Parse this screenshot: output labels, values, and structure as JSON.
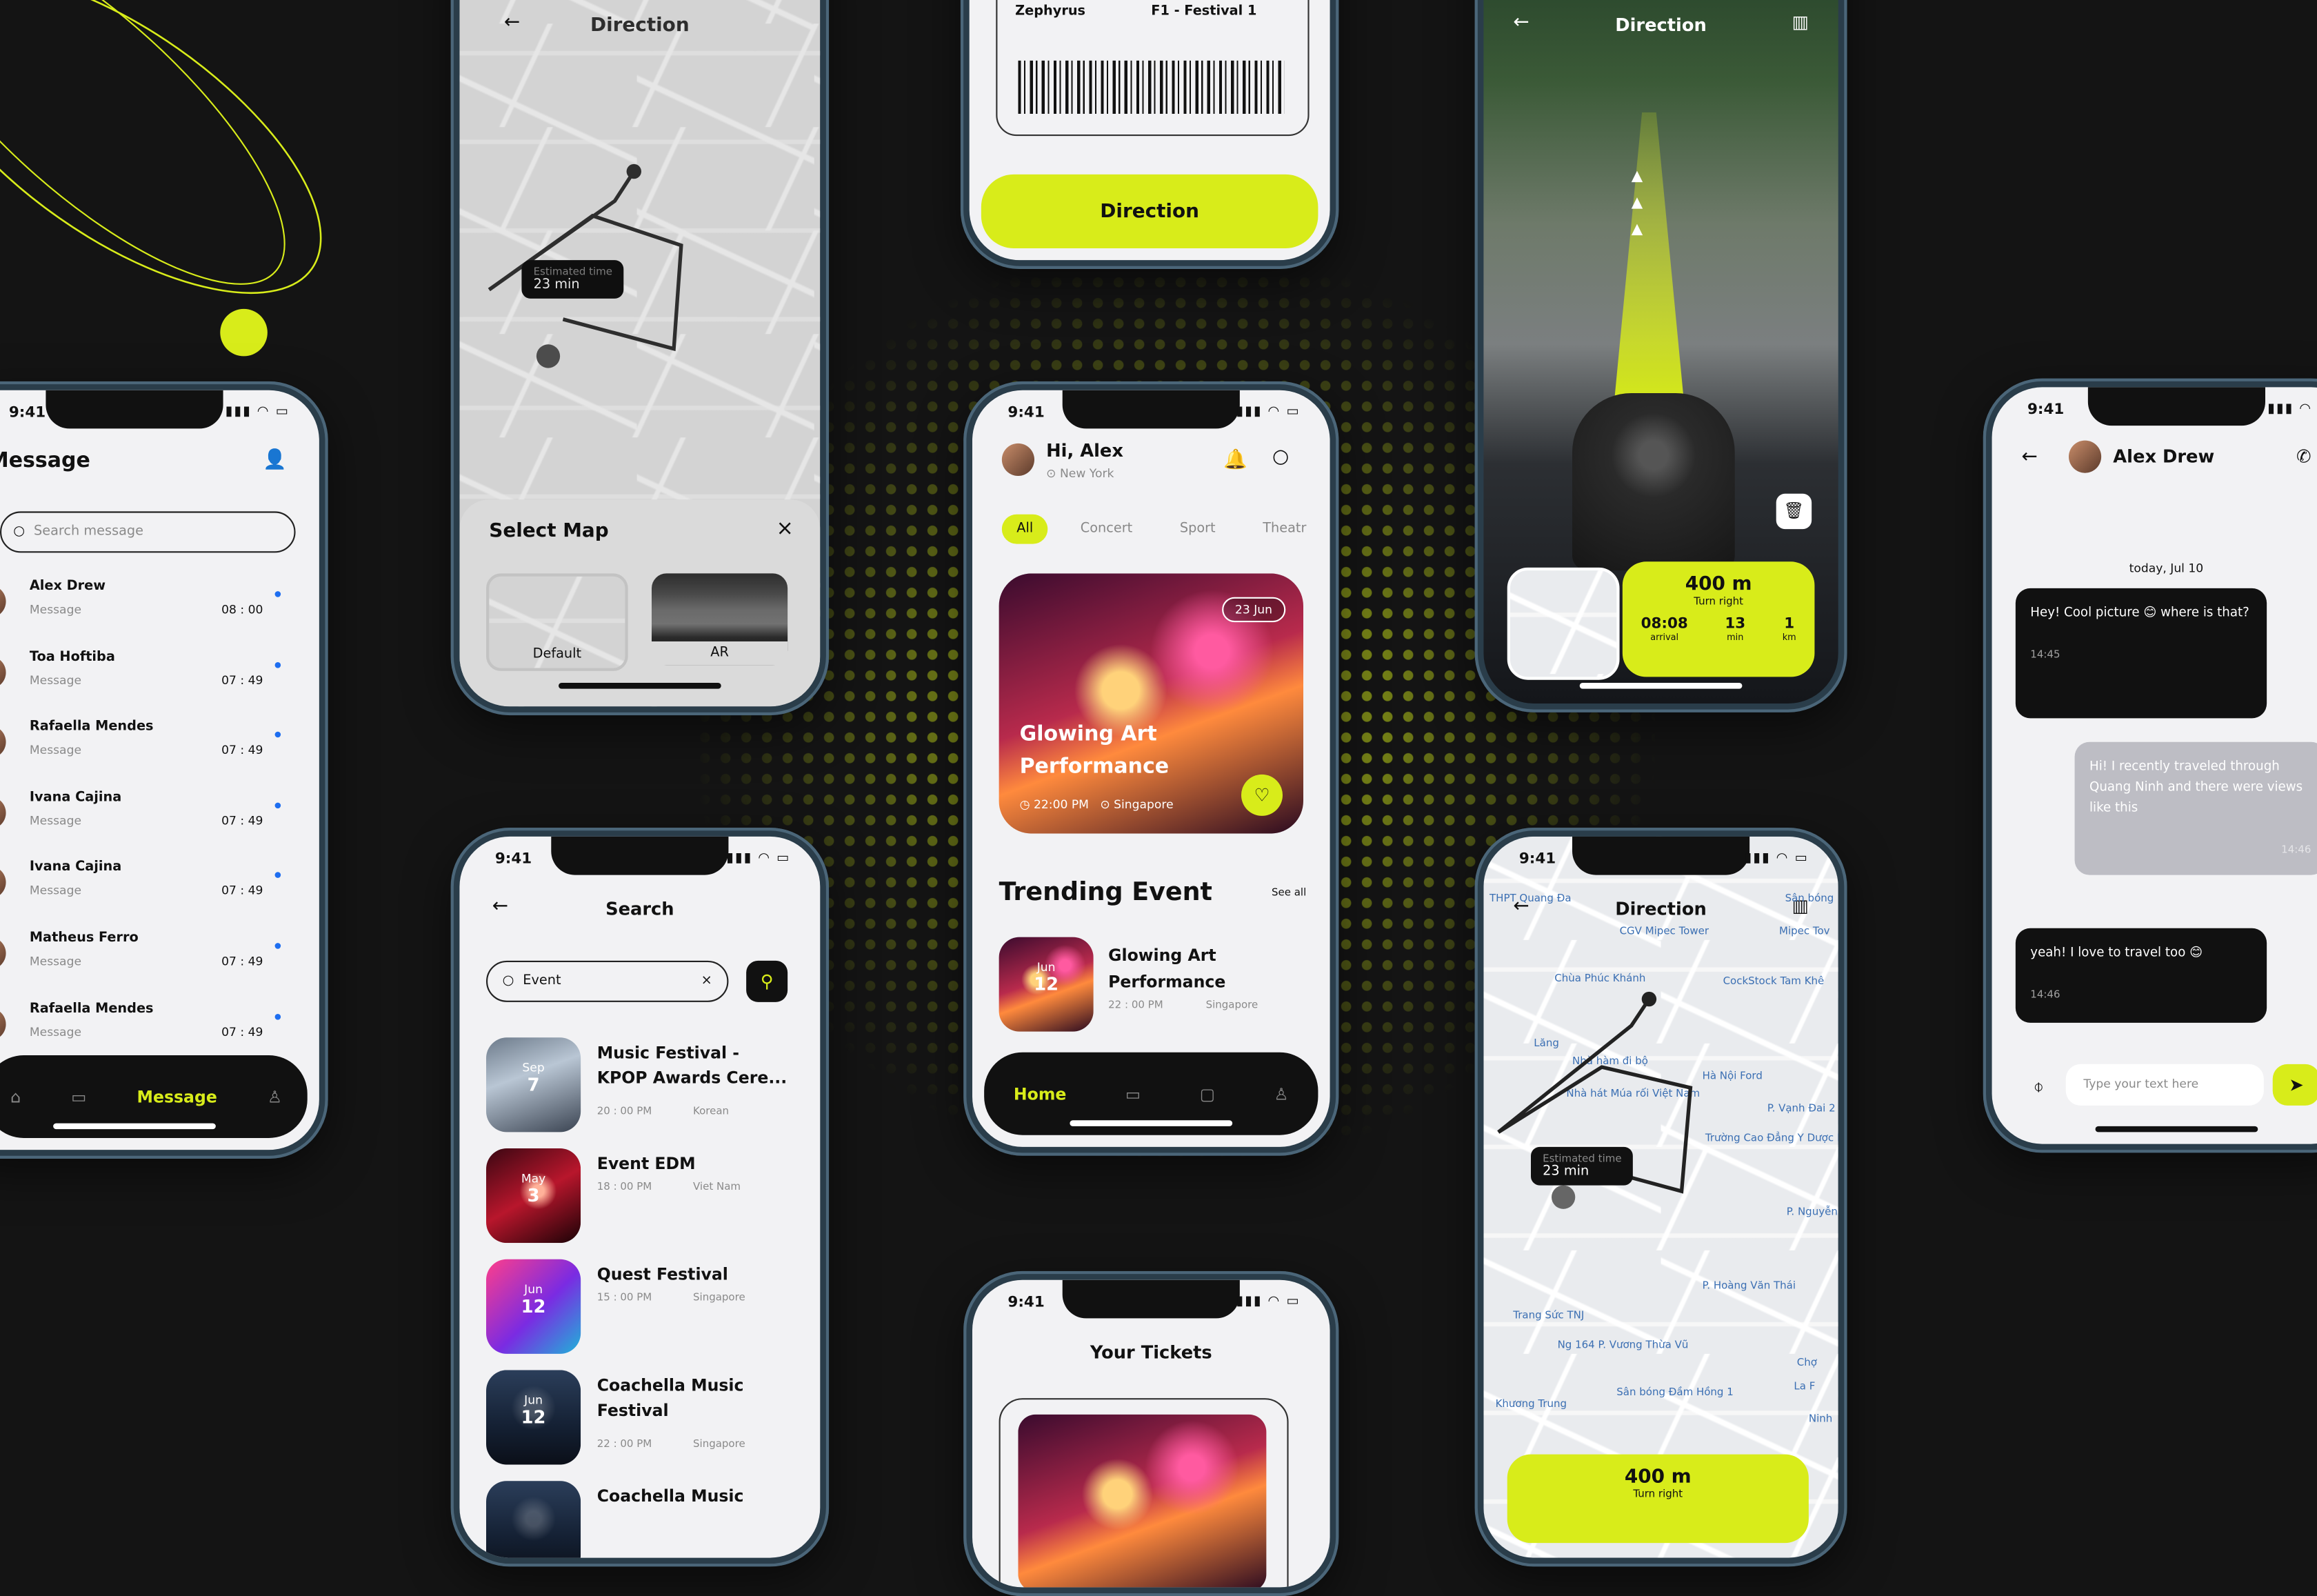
{
  "status_time": "9:41",
  "message_screen": {
    "title": "Message",
    "search_placeholder": "Search message",
    "items": [
      {
        "name": "Alex Drew",
        "preview": "Message",
        "time": "08 : 00"
      },
      {
        "name": "Toa Hoftiba",
        "preview": "Message",
        "time": "07 : 49"
      },
      {
        "name": "Rafaella Mendes",
        "preview": "Message",
        "time": "07 : 49"
      },
      {
        "name": "Ivana Cajina",
        "preview": "Message",
        "time": "07 : 49"
      },
      {
        "name": "Ivana Cajina",
        "preview": "Message",
        "time": "07 : 49"
      },
      {
        "name": "Matheus Ferro",
        "preview": "Message",
        "time": "07 : 49"
      },
      {
        "name": "Rafaella Mendes",
        "preview": "Message",
        "time": "07 : 49"
      }
    ],
    "nav_active": "Message"
  },
  "select_map": {
    "header": "Direction",
    "title": "Select Map",
    "close": "×",
    "options": [
      "Default",
      "AR"
    ],
    "estimated_label": "Estimated time",
    "estimated_value": "23 min"
  },
  "ticket_top": {
    "left_value": "Zephyrus",
    "right_value": "F1 - Festival 1",
    "button": "Direction"
  },
  "home": {
    "greeting": "Hi, Alex",
    "location": "New York",
    "tabs": [
      "All",
      "Concert",
      "Sport",
      "Theatr"
    ],
    "featured": {
      "date": "23 Jun",
      "title": "Glowing Art Performance",
      "time": "22:00 PM",
      "place": "Singapore"
    },
    "section_title": "Trending Event",
    "see_all": "See all",
    "trending": {
      "month": "Jun",
      "day": "12",
      "title": "Glowing Art Performance",
      "time": "22 : 00 PM",
      "place": "Singapore"
    },
    "nav_active": "Home"
  },
  "search": {
    "title": "Search",
    "query": "Event",
    "clear": "×",
    "results": [
      {
        "month": "Sep",
        "day": "7",
        "title": "Music Festival - KPOP Awards Cere...",
        "time": "20 : 00 PM",
        "place": "Korean"
      },
      {
        "month": "May",
        "day": "3",
        "title": "Event EDM",
        "time": "18 : 00 PM",
        "place": "Viet Nam"
      },
      {
        "month": "Jun",
        "day": "12",
        "title": "Quest Festival",
        "time": "15 : 00 PM",
        "place": "Singapore"
      },
      {
        "month": "Jun",
        "day": "12",
        "title": "Coachella Music Festival",
        "time": "22 : 00 PM",
        "place": "Singapore"
      },
      {
        "month": "",
        "day": "",
        "title": "Coachella Music",
        "time": "",
        "place": ""
      }
    ]
  },
  "tickets": {
    "title": "Your Tickets"
  },
  "ar_direction": {
    "header": "Direction",
    "distance": "400 m",
    "turn": "Turn right",
    "stats": [
      {
        "value": "08:08",
        "label": "arrival"
      },
      {
        "value": "13",
        "label": "min"
      },
      {
        "value": "1",
        "label": "km"
      }
    ]
  },
  "map_direction": {
    "header": "Direction",
    "places": [
      "Chùa Phúc Khánh",
      "CGV Mipec Tower",
      "CockStock Tam Khê",
      "Nhà hát Múa rối Việt Nam",
      "Hà Nội Ford",
      "Trường Cao Đẳng Y Dược Hà Nội",
      "Trang Sức TNJ",
      "Sân bóng Đầm Hồng 1",
      "P. Vạnh Đai 2",
      "P. Hoàng Văn Thái",
      "Mipec Tov",
      "THPT Quang Đa",
      "Sân bóng",
      "Chợ",
      "Ninh",
      "La F",
      "Nhà hàm đi bộ",
      "Lăng",
      "Ng 164 P. Vương Thừa Vũ",
      "P. Nguyễn",
      "Khương Trung"
    ],
    "estimated_label": "Estimated time",
    "estimated_value": "23 min",
    "distance": "400 m",
    "turn": "Turn right"
  },
  "chat": {
    "contact": "Alex Drew",
    "date": "today, Jul 10",
    "messages": [
      {
        "side": "left",
        "text": "Hey! Cool picture 😊 where is that?",
        "time": "14:45"
      },
      {
        "side": "right",
        "text": "Hi! I recently traveled through Quang Ninh and there were views like this",
        "time": "14:46"
      },
      {
        "side": "left",
        "text": "yeah! I love to travel too 😊",
        "time": "14:46"
      }
    ],
    "input_placeholder": "Type your text here"
  },
  "colors": {
    "accent": "#d8ec1a",
    "dark": "#111111",
    "background": "#141414"
  }
}
